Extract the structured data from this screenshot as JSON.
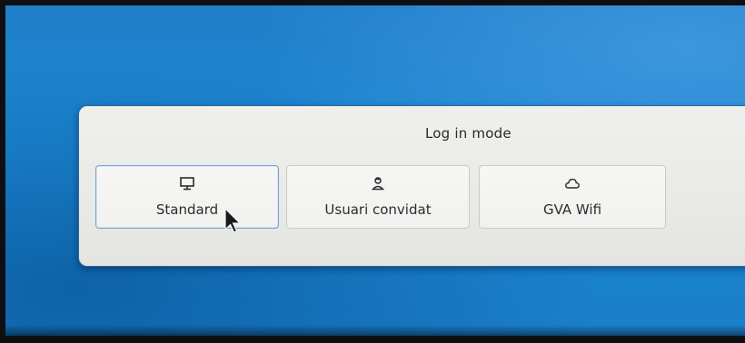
{
  "dialog": {
    "title": "Log in mode",
    "buttons": [
      {
        "label": "Standard",
        "icon": "monitor-icon",
        "selected": true
      },
      {
        "label": "Usuari convidat",
        "icon": "guest-user-icon",
        "selected": false
      },
      {
        "label": "GVA Wifi",
        "icon": "cloud-icon",
        "selected": false
      }
    ]
  },
  "colors": {
    "desktop_background": "#1b86d2",
    "dialog_background": "#ebebe8",
    "selected_border": "#6ea3d6"
  }
}
